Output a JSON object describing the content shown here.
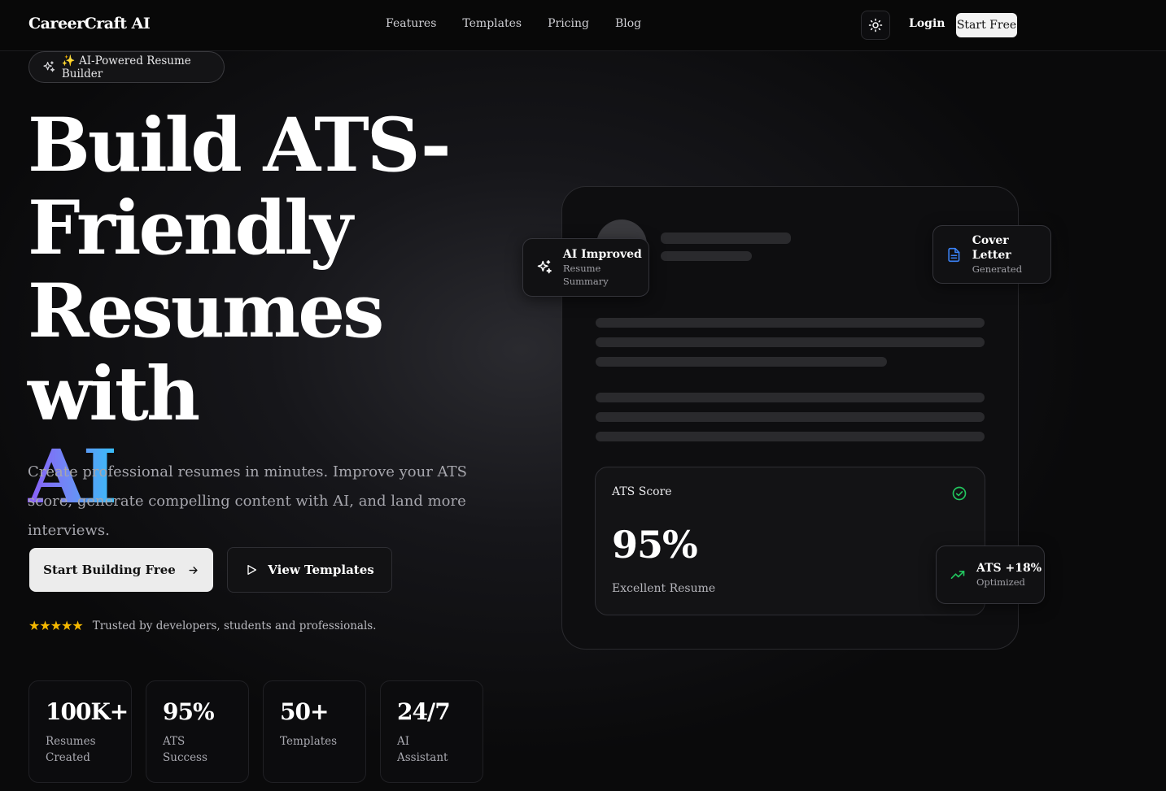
{
  "nav": {
    "brand": "CareerCraft AI",
    "links": [
      "Features",
      "Templates",
      "Pricing",
      "Blog"
    ],
    "login": "Login",
    "start_free": "Start Free"
  },
  "hero": {
    "badge": "✨ AI-Powered Resume Builder",
    "headline_1": "Build ATS-",
    "headline_2": "Friendly",
    "headline_3": "Resumes with",
    "headline_ai": "AI",
    "subtitle": "Create professional resumes in minutes. Improve your ATS score, generate compelling content with AI, and land more interviews.",
    "cta_primary": "Start Building Free",
    "cta_secondary": "View Templates",
    "stars": "★★★★★",
    "trust": "Trusted by developers, students and professionals."
  },
  "stats": [
    {
      "value": "100K+",
      "label": "Resumes Created"
    },
    {
      "value": "95%",
      "label": "ATS Success"
    },
    {
      "value": "50+",
      "label": "Templates"
    },
    {
      "value": "24/7",
      "label": "AI Assistant"
    }
  ],
  "mockup": {
    "ai_improved": {
      "title": "AI Improved",
      "sub": "Resume Summary"
    },
    "cover_letter": {
      "title": "Cover Letter",
      "sub": "Generated"
    },
    "ats": {
      "title": "ATS Score",
      "score": "95%",
      "sub": "Excellent Resume"
    },
    "ats_boost": {
      "title": "ATS +18%",
      "sub": "Optimized"
    }
  },
  "colors": {
    "accent_gradient_start": "#8b5cf6",
    "accent_gradient_end": "#38bdf8",
    "success": "#22c55e",
    "doc_icon": "#3b82f6",
    "stars": "#f5b800"
  }
}
